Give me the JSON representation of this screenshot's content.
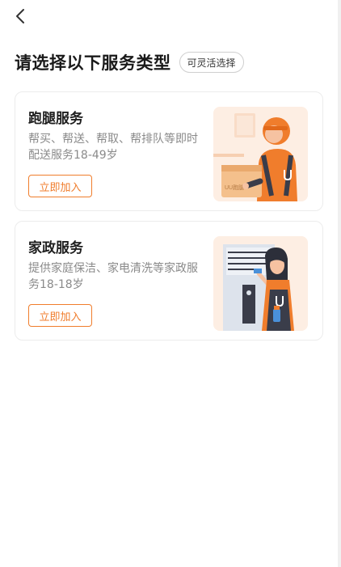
{
  "header": {
    "title": "请选择以下服务类型",
    "badge": "可灵活选择"
  },
  "services": [
    {
      "title": "跑腿服务",
      "description": "帮买、帮送、帮取、帮排队等即时配送服务18-49岁",
      "button_label": "立即加入",
      "box_label": "UU跑腿"
    },
    {
      "title": "家政服务",
      "description": "提供家庭保洁、家电清洗等家政服务18-18岁",
      "button_label": "立即加入"
    }
  ],
  "colors": {
    "accent": "#f07d2c",
    "illustration_bg": "#fdeee3"
  },
  "icons": {
    "back": "chevron-left-icon"
  }
}
